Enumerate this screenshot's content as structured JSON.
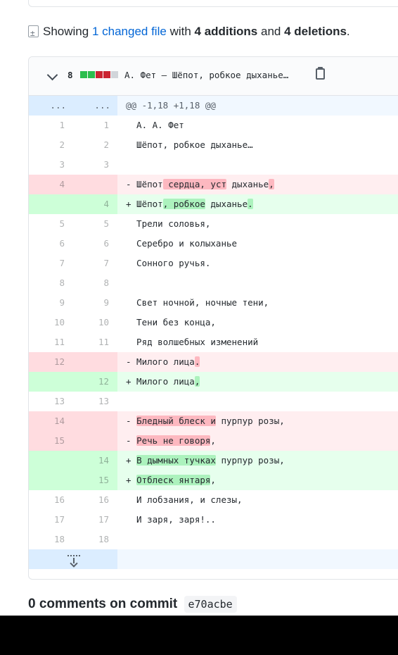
{
  "summary": {
    "prefix": "Showing",
    "changed_link": "1 changed file",
    "with": "with",
    "additions": "4 additions",
    "and": "and",
    "deletions": "4 deletions",
    "end": "."
  },
  "file": {
    "changes_count": "8",
    "diffstat_colors": [
      "#2cbe4e",
      "#2cbe4e",
      "#cb2431",
      "#cb2431",
      "#d1d5da"
    ],
    "name": "А. Фет — Шёпот, робкое дыханье…"
  },
  "hunk": {
    "left": "...",
    "right": "...",
    "text": "@@ -1,18 +1,18 @@"
  },
  "lines": [
    {
      "type": "ctx",
      "left": "1",
      "right": "1",
      "parts": [
        {
          "t": "  А. А. Фет"
        }
      ]
    },
    {
      "type": "ctx",
      "left": "2",
      "right": "2",
      "parts": [
        {
          "t": "  Шёпот, робкое дыханье…"
        }
      ]
    },
    {
      "type": "ctx",
      "left": "3",
      "right": "3",
      "parts": [
        {
          "t": ""
        }
      ]
    },
    {
      "type": "del",
      "left": "4",
      "right": "",
      "parts": [
        {
          "t": "- Шёпот"
        },
        {
          "t": " сердца, уст",
          "h": true
        },
        {
          "t": " дыханье"
        },
        {
          "t": ",",
          "h": true
        }
      ]
    },
    {
      "type": "add",
      "left": "",
      "right": "4",
      "parts": [
        {
          "t": "+ Шёпот"
        },
        {
          "t": ", робкое",
          "h": true
        },
        {
          "t": " дыханье"
        },
        {
          "t": ".",
          "h": true
        }
      ]
    },
    {
      "type": "ctx",
      "left": "5",
      "right": "5",
      "parts": [
        {
          "t": "  Трели соловья,"
        }
      ]
    },
    {
      "type": "ctx",
      "left": "6",
      "right": "6",
      "parts": [
        {
          "t": "  Серебро и колыханье"
        }
      ]
    },
    {
      "type": "ctx",
      "left": "7",
      "right": "7",
      "parts": [
        {
          "t": "  Сонного ручья."
        }
      ]
    },
    {
      "type": "ctx",
      "left": "8",
      "right": "8",
      "parts": [
        {
          "t": ""
        }
      ]
    },
    {
      "type": "ctx",
      "left": "9",
      "right": "9",
      "parts": [
        {
          "t": "  Свет ночной, ночные тени,"
        }
      ]
    },
    {
      "type": "ctx",
      "left": "10",
      "right": "10",
      "parts": [
        {
          "t": "  Тени без конца,"
        }
      ]
    },
    {
      "type": "ctx",
      "left": "11",
      "right": "11",
      "parts": [
        {
          "t": "  Ряд волшебных изменений"
        }
      ]
    },
    {
      "type": "del",
      "left": "12",
      "right": "",
      "parts": [
        {
          "t": "- Милого лица"
        },
        {
          "t": ".",
          "h": true
        }
      ]
    },
    {
      "type": "add",
      "left": "",
      "right": "12",
      "parts": [
        {
          "t": "+ Милого лица"
        },
        {
          "t": ",",
          "h": true
        }
      ]
    },
    {
      "type": "ctx",
      "left": "13",
      "right": "13",
      "parts": [
        {
          "t": ""
        }
      ]
    },
    {
      "type": "del",
      "left": "14",
      "right": "",
      "parts": [
        {
          "t": "- "
        },
        {
          "t": "Бледный блеск и",
          "h": true
        },
        {
          "t": " пурпур розы,"
        }
      ]
    },
    {
      "type": "del",
      "left": "15",
      "right": "",
      "parts": [
        {
          "t": "- "
        },
        {
          "t": "Речь не говоря",
          "h": true
        },
        {
          "t": ","
        }
      ]
    },
    {
      "type": "add",
      "left": "",
      "right": "14",
      "parts": [
        {
          "t": "+ "
        },
        {
          "t": "В дымных тучках",
          "h": true
        },
        {
          "t": " пурпур розы,"
        }
      ]
    },
    {
      "type": "add",
      "left": "",
      "right": "15",
      "parts": [
        {
          "t": "+ "
        },
        {
          "t": "Отблеск янтаря",
          "h": true
        },
        {
          "t": ","
        }
      ]
    },
    {
      "type": "ctx",
      "left": "16",
      "right": "16",
      "parts": [
        {
          "t": "  И лобзания, и слезы,"
        }
      ]
    },
    {
      "type": "ctx",
      "left": "17",
      "right": "17",
      "parts": [
        {
          "t": "  И заря, заря!.."
        }
      ]
    },
    {
      "type": "ctx",
      "left": "18",
      "right": "18",
      "parts": [
        {
          "t": ""
        }
      ]
    }
  ],
  "comments": {
    "label": "0 comments on commit",
    "sha": "e70acbe"
  }
}
